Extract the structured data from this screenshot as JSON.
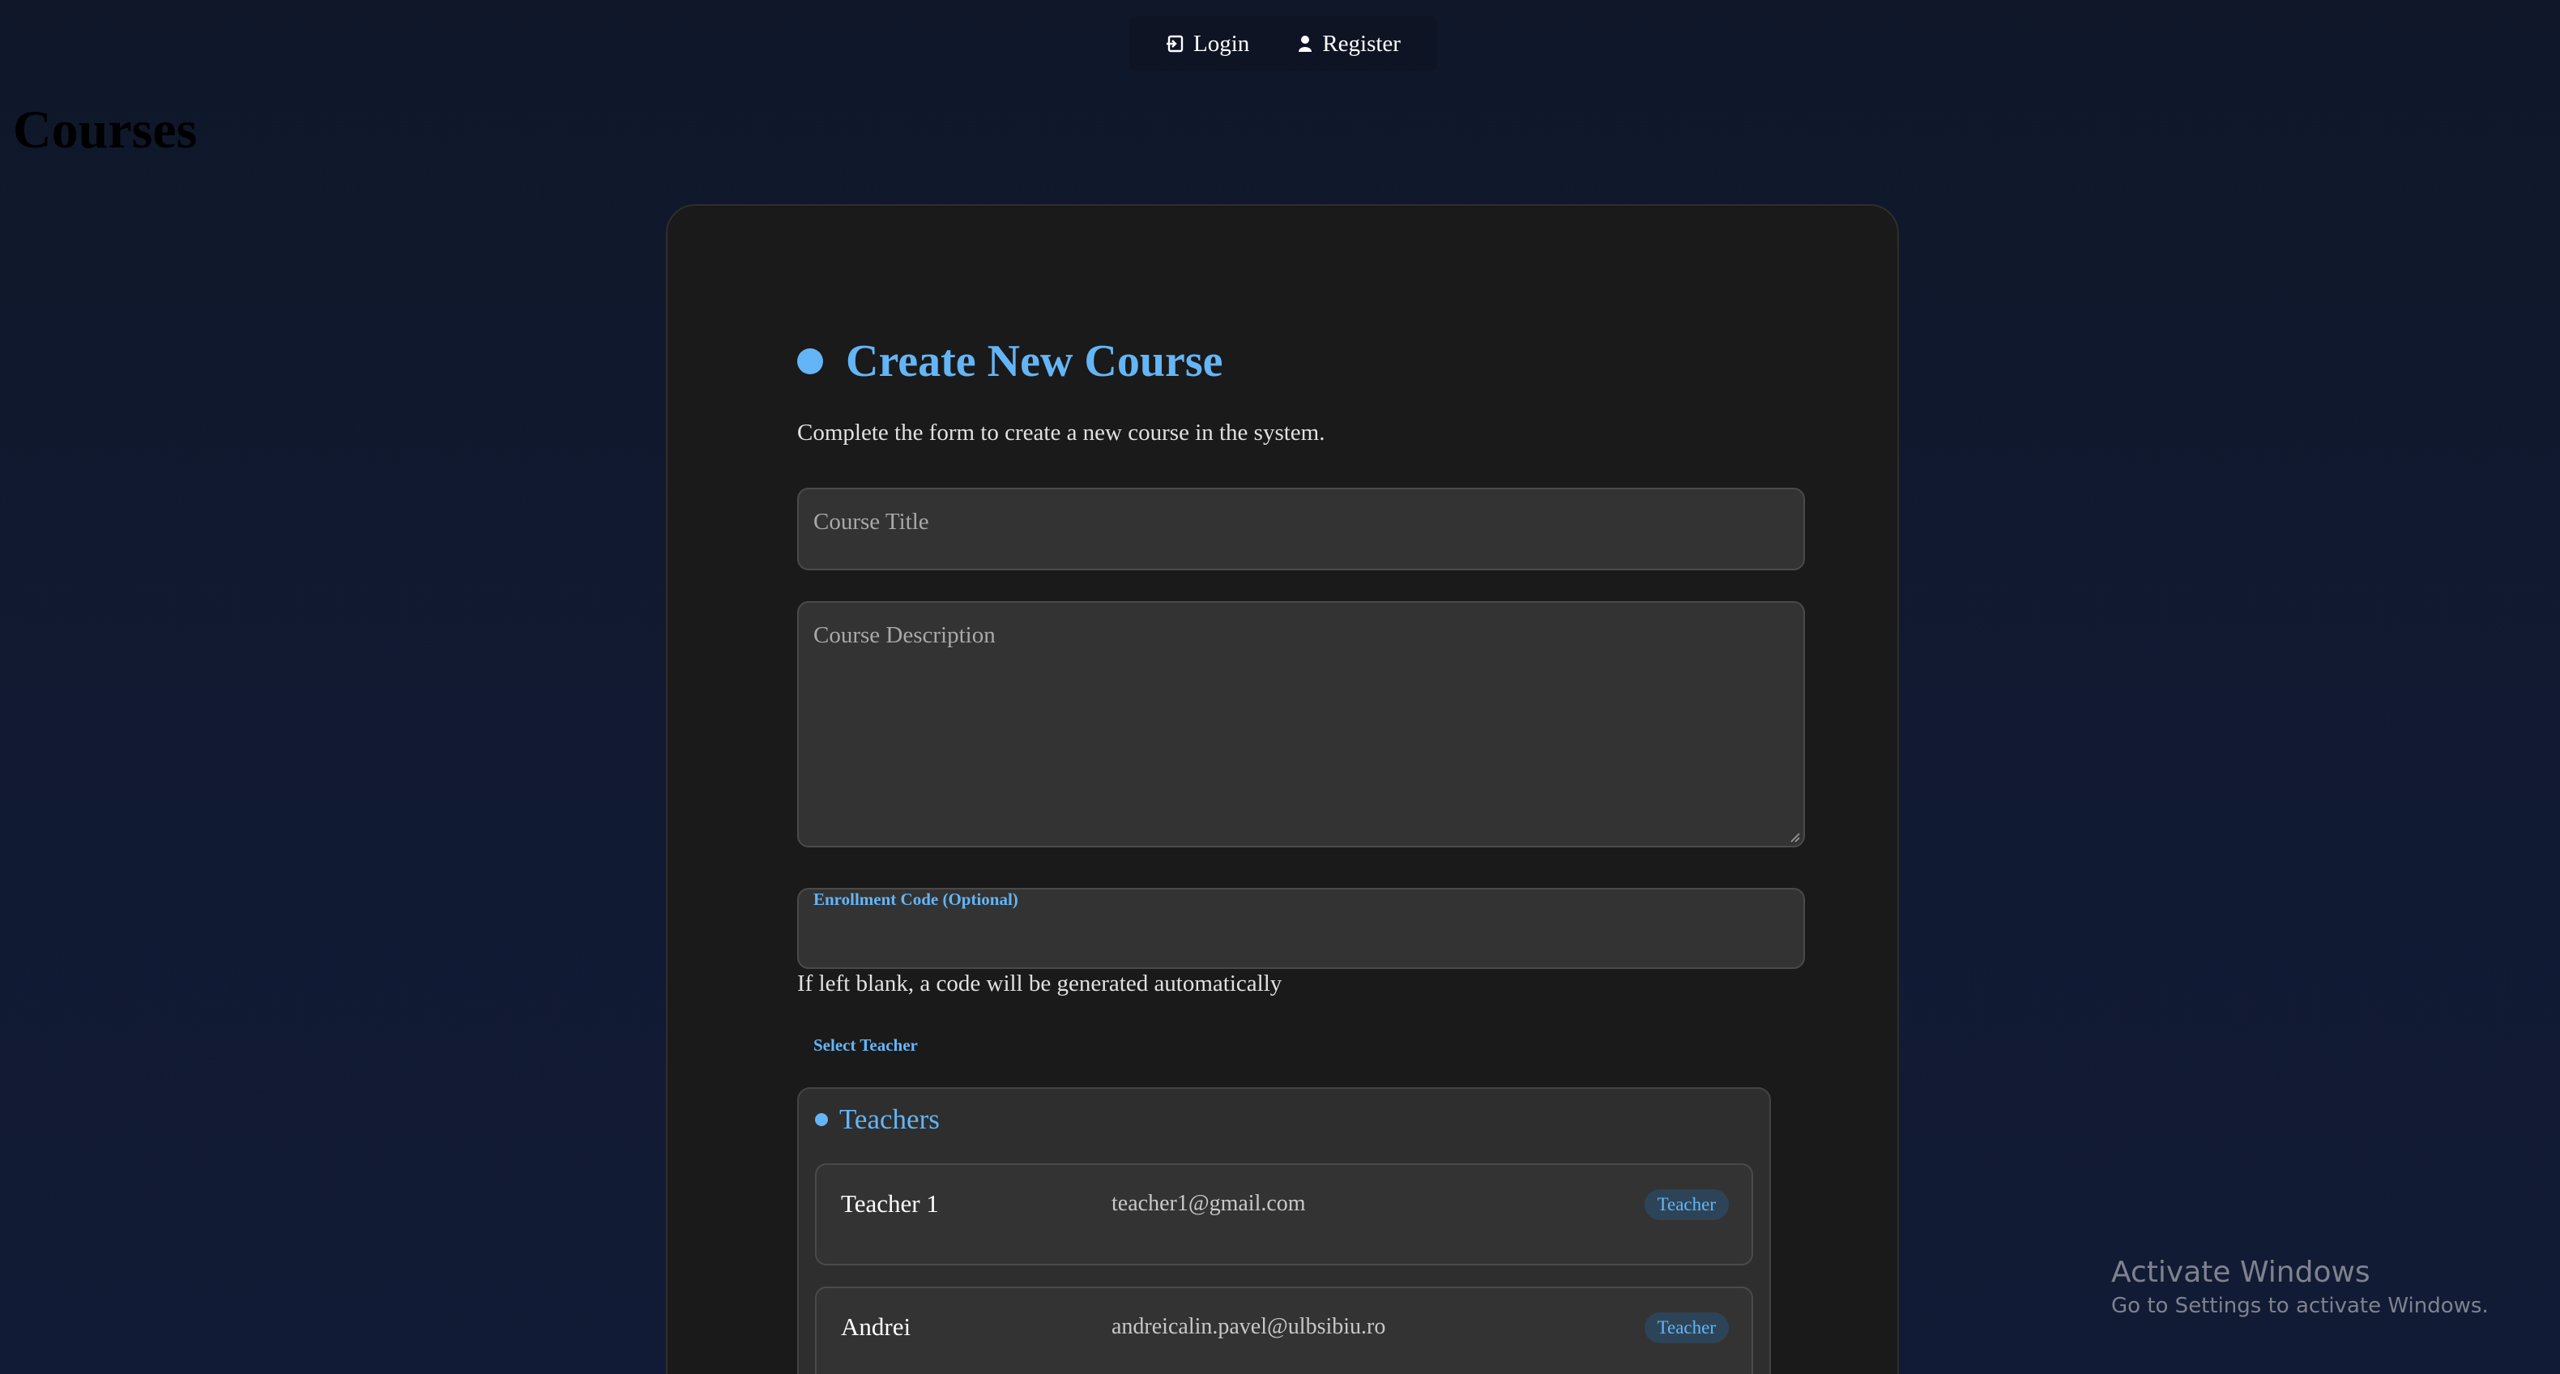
{
  "nav": {
    "login_label": "Login",
    "register_label": "Register"
  },
  "page": {
    "title": "Courses"
  },
  "form": {
    "heading": "Create New Course",
    "subtitle": "Complete the form to create a new course in the system.",
    "course_title": {
      "placeholder": "Course Title",
      "value": ""
    },
    "course_description": {
      "placeholder": "Course Description",
      "value": ""
    },
    "enrollment_code": {
      "label": "Enrollment Code (Optional)",
      "value": ""
    },
    "enrollment_helper": "If left blank, a code will be generated automatically",
    "select_teacher_label": "Select Teacher",
    "teachers_title": "Teachers",
    "teachers": [
      {
        "name": "Teacher 1",
        "email": "teacher1@gmail.com",
        "role": "Teacher"
      },
      {
        "name": "Andrei",
        "email": "andreicalin.pavel@ulbsibiu.ro",
        "role": "Teacher"
      }
    ]
  },
  "watermark": {
    "title": "Activate Windows",
    "subtitle": "Go to Settings to activate Windows."
  },
  "colors": {
    "accent": "#64b5f6",
    "card_bg": "#1a1a1a",
    "page_bg": "#111a33",
    "field_bg": "#333333"
  }
}
